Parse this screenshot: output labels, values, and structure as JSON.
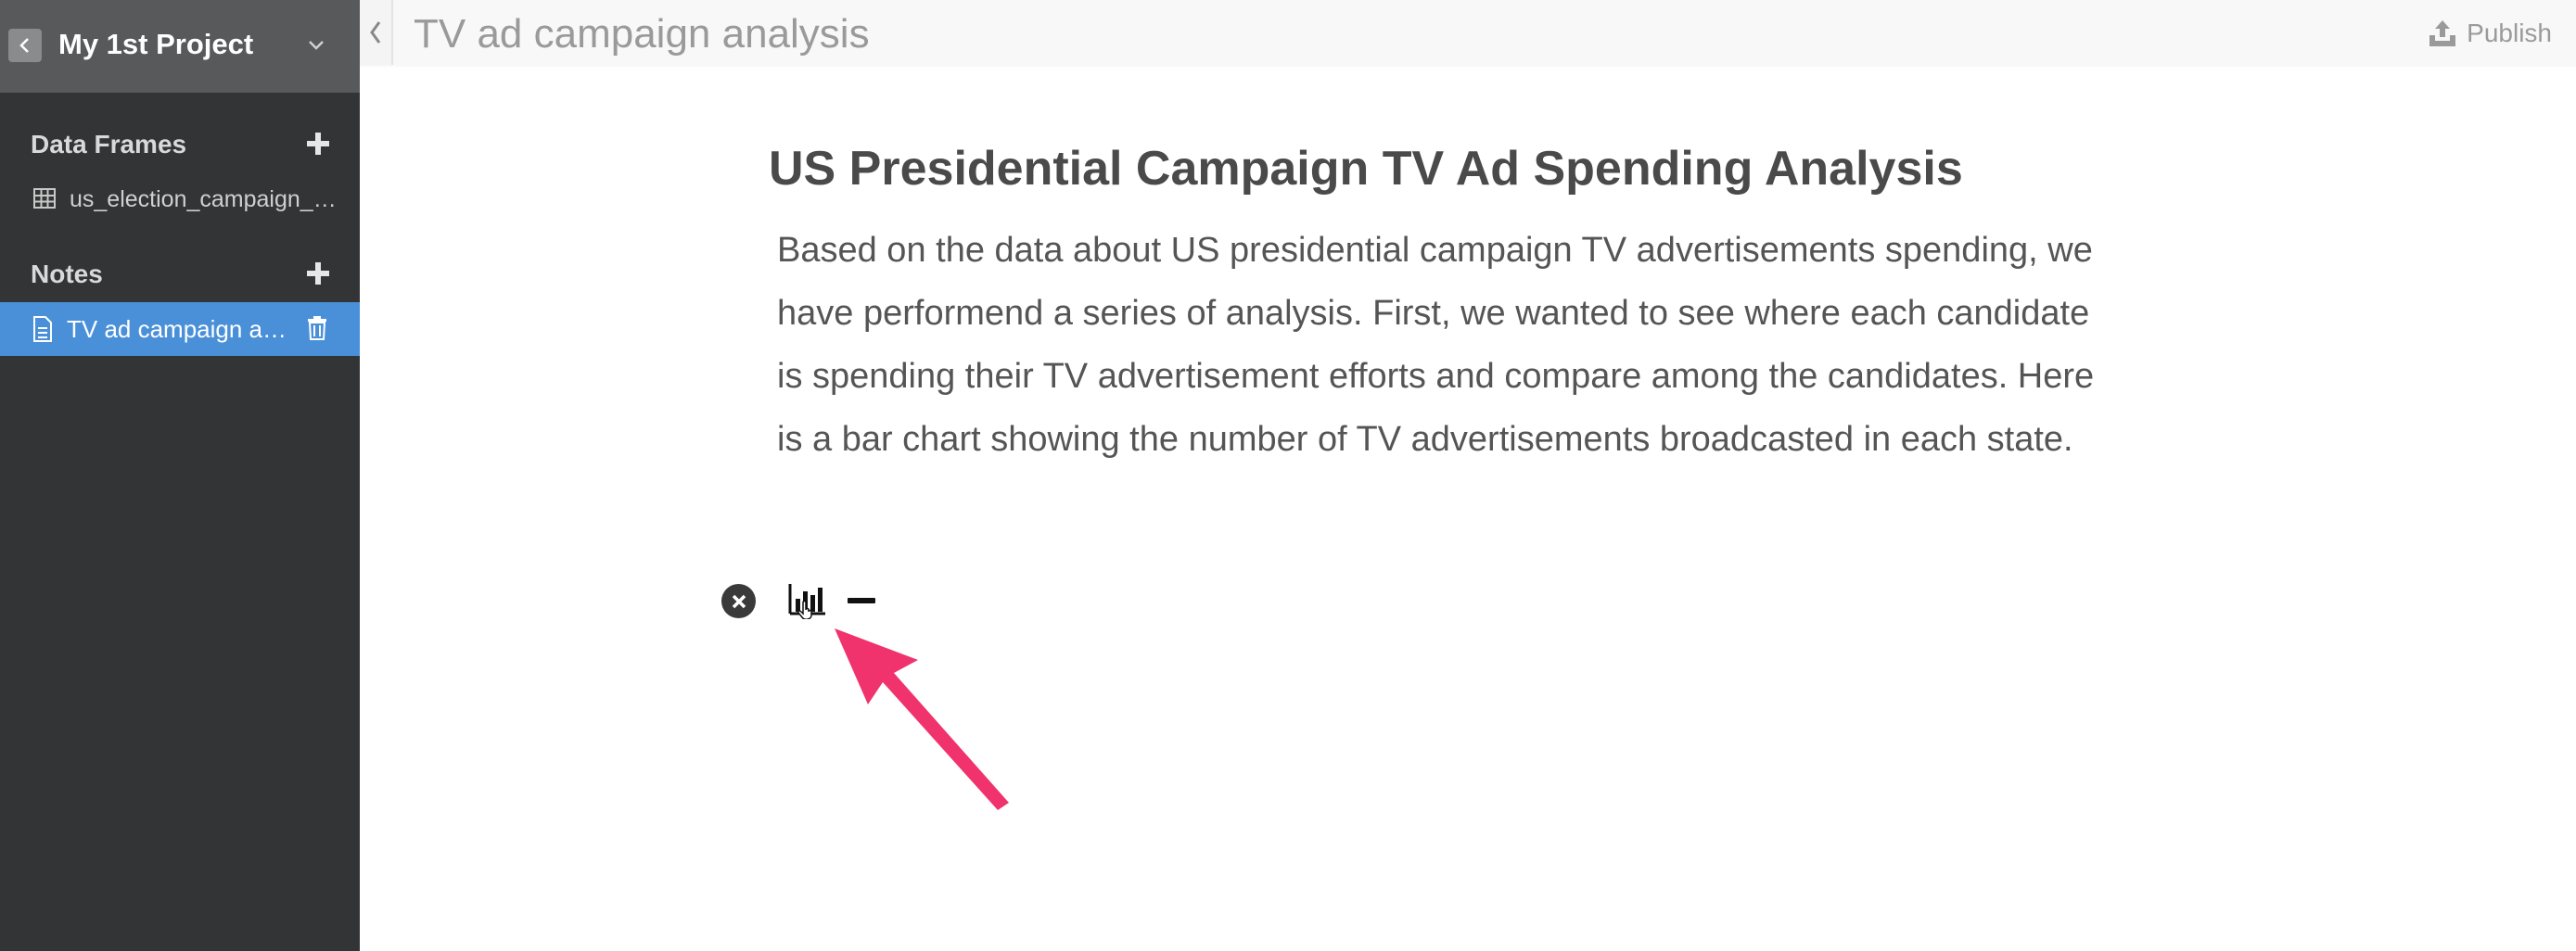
{
  "sidebar": {
    "project_title": "My 1st Project",
    "data_frames_label": "Data Frames",
    "data_frames": [
      {
        "label": "us_election_campaign_tv_ads"
      }
    ],
    "notes_label": "Notes",
    "notes": [
      {
        "label": "TV ad campaign analysis",
        "selected": true
      }
    ]
  },
  "topbar": {
    "title": "TV ad campaign analysis",
    "publish_label": "Publish"
  },
  "note": {
    "heading": "US Presidential Campaign TV Ad Spending Analysis",
    "body": "Based on the data about US presidential campaign TV advertisements spending, we have performend a series of analysis. First, we wanted to see where each candidate is spending their TV advertisement efforts and compare among the candidates. Here is a bar chart showing the number of TV advertisements broadcasted in each state."
  },
  "toolbar": {
    "icons": [
      "close-circle-icon",
      "bar-chart-icon",
      "minus-icon"
    ]
  },
  "colors": {
    "sidebar_bg": "#333435",
    "project_header_bg": "#58595a",
    "selected_item_bg": "#4a90d9",
    "annotation_arrow": "#f0336d"
  }
}
